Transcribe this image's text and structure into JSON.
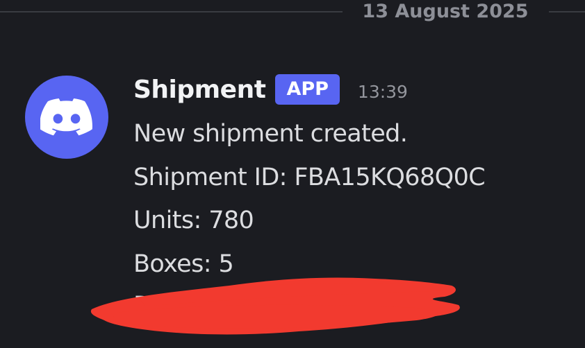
{
  "divider": {
    "date": "13 August 2025"
  },
  "message": {
    "author": "Shipment",
    "badge": "APP",
    "time": "13:39",
    "lines": [
      "New shipment created.",
      "Shipment ID: FBA15KQ68Q0C",
      "Units: 780",
      "Boxes: 5",
      "Di"
    ]
  },
  "avatar_icon": "discord-logo-icon",
  "colors": {
    "background": "#1b1c21",
    "brand": "#5865f2",
    "redaction": "#f23a2f",
    "text": "#dcdde0",
    "muted": "#8d8f97"
  }
}
